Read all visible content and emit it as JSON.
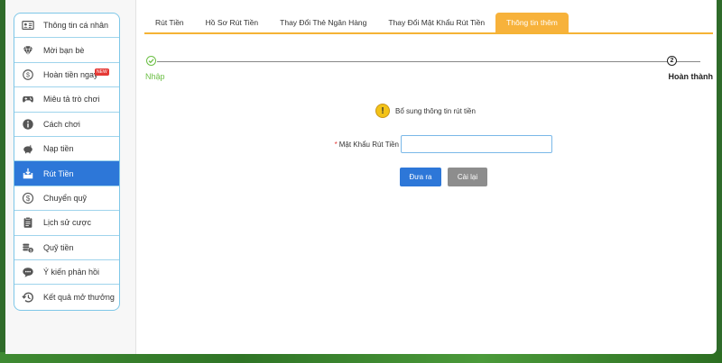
{
  "sidebar": {
    "items": [
      {
        "label": "Thông tin cá nhân",
        "icon": "id-card-icon",
        "active": false
      },
      {
        "label": "Mời bạn bè",
        "icon": "diamond-icon",
        "active": false
      },
      {
        "label": "Hoàn tiền ngay",
        "icon": "cashback-icon",
        "active": false,
        "badge": "NEW"
      },
      {
        "label": "Miêu tả trò chơi",
        "icon": "gamepad-icon",
        "active": false
      },
      {
        "label": "Cách chơi",
        "icon": "info-icon",
        "active": false
      },
      {
        "label": "Nạp tiền",
        "icon": "piggy-bank-icon",
        "active": false
      },
      {
        "label": "Rút Tiền",
        "icon": "withdraw-icon",
        "active": true
      },
      {
        "label": "Chuyển quỹ",
        "icon": "dollar-circle-icon",
        "active": false
      },
      {
        "label": "Lịch sử cược",
        "icon": "clipboard-icon",
        "active": false
      },
      {
        "label": "Quỹ tiền",
        "icon": "coins-icon",
        "active": false
      },
      {
        "label": "Ý kiến phản hồi",
        "icon": "chat-icon",
        "active": false
      },
      {
        "label": "Kết quả mở thưởng",
        "icon": "history-icon",
        "active": false
      }
    ]
  },
  "tabs": [
    {
      "label": "Rút Tiền",
      "active": false
    },
    {
      "label": "Hồ Sơ Rút Tiền",
      "active": false
    },
    {
      "label": "Thay Đổi Thẻ Ngân Hàng",
      "active": false
    },
    {
      "label": "Thay Đổi Mật Khẩu Rút Tiền",
      "active": false
    },
    {
      "label": "Thông tin thêm",
      "active": true
    }
  ],
  "stepper": {
    "step1_label": "Nhập",
    "step2_number": "2",
    "step2_label": "Hoàn thành"
  },
  "notice": {
    "icon_text": "!",
    "text": "Bổ sung thông tin rút tiền"
  },
  "form": {
    "required_mark": "*",
    "password_label": "Mật Khẩu Rút Tiền",
    "password_value": "",
    "submit_label": "Đưa ra",
    "reset_label": "Cài lại"
  },
  "colors": {
    "accent_blue": "#2d77d8",
    "tab_active": "#f7b23b",
    "step_done": "#6cbf45"
  }
}
